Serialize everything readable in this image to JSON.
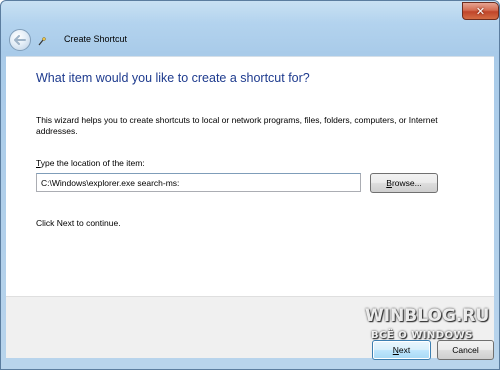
{
  "window": {
    "close_glyph": "✕"
  },
  "header": {
    "title": "Create Shortcut"
  },
  "content": {
    "main_instruction": "What item would you like to create a shortcut for?",
    "description": "This wizard helps you to create shortcuts to local or network programs, files, folders, computers, or Internet addresses.",
    "location_label_first": "T",
    "location_label_rest": "ype the location of the item:",
    "location_value": "C:\\Windows\\explorer.exe search-ms:",
    "browse_first": "B",
    "browse_rest": "rowse...",
    "hint": "Click Next to continue."
  },
  "footer": {
    "next_first": "N",
    "next_rest": "ext",
    "cancel_label": "Cancel"
  },
  "watermark": {
    "main": "WINBLOG.RU",
    "sub": "ВСЁ О WINDOWS"
  },
  "icons": {
    "back": "back-arrow-icon",
    "wizard": "shortcut-wizard-icon",
    "close": "close-icon"
  },
  "colors": {
    "instruction": "#1e3b8e",
    "frame": "#b3d3ee",
    "close": "#c0452a"
  }
}
